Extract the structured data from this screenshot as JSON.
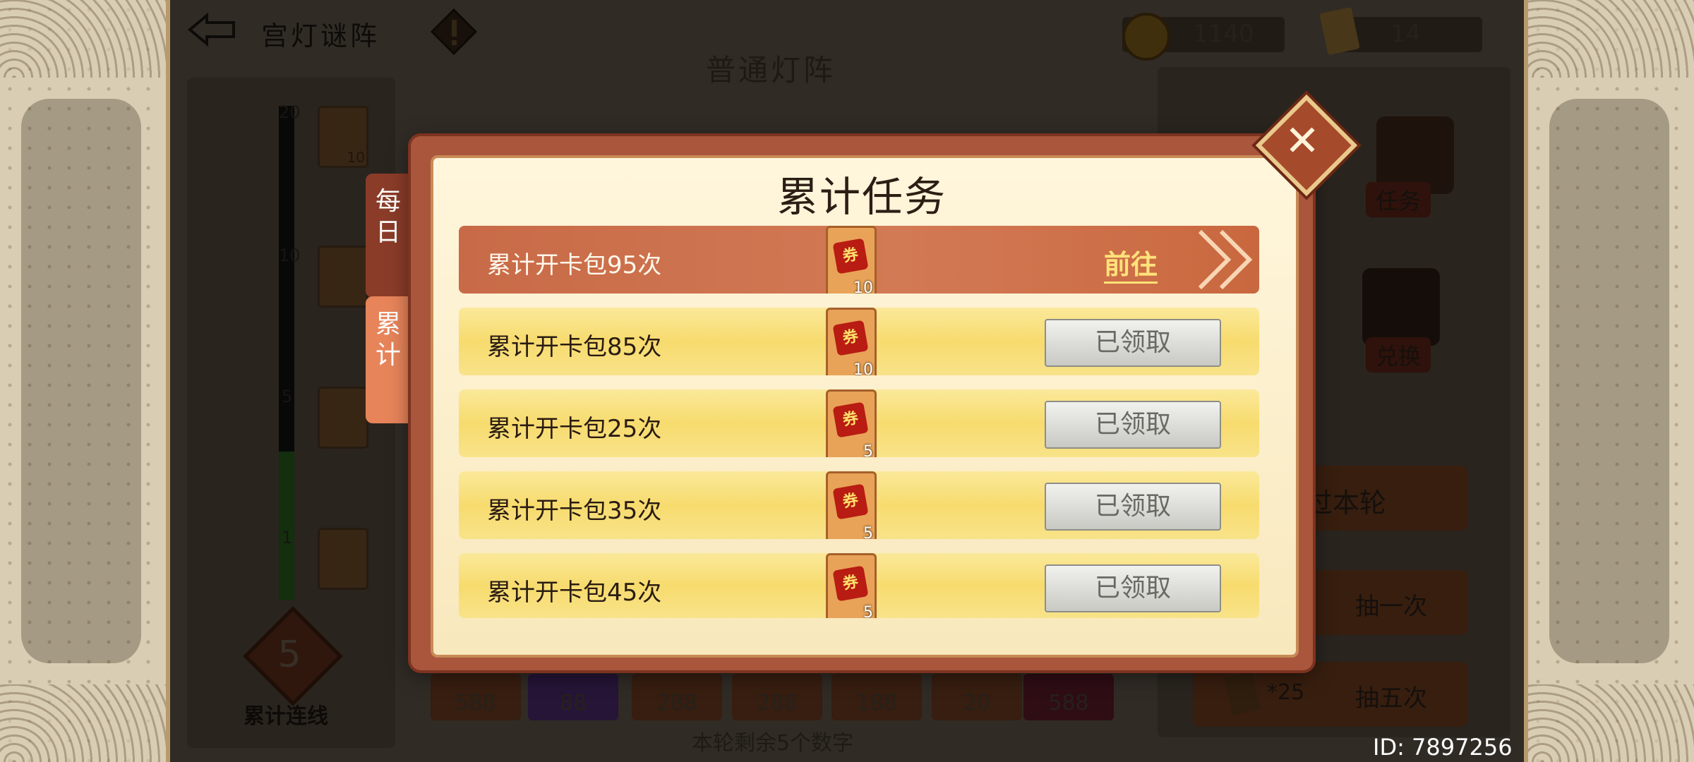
{
  "header": {
    "title": "宫灯谜阵",
    "coins": "1140",
    "tickets": "14"
  },
  "mode_title": "普通灯阵",
  "progress": {
    "ticks": [
      "20",
      "10",
      "5",
      "1"
    ],
    "reward_counts": [
      "10"
    ],
    "fill_fraction": 0.3
  },
  "streak": {
    "value": "5",
    "label": "累计连线"
  },
  "right": {
    "task_label": "任务",
    "exchange_label": "兑换",
    "skip_label": "过本轮",
    "draw_one": "抽一次",
    "draw_five": "抽五次",
    "cost_five": "*25"
  },
  "bottom_chips": [
    "588",
    "88",
    "288",
    "288",
    "188",
    "20",
    "588"
  ],
  "round_remaining": "本轮剩余5个数字",
  "user_id": "ID: 7897256",
  "modal": {
    "title": "累计任务",
    "tabs": [
      "每日",
      "累计"
    ],
    "tasks": [
      {
        "label": "累计开卡包95次",
        "reward": "10",
        "status": "前往"
      },
      {
        "label": "累计开卡包85次",
        "reward": "10",
        "status": "已领取"
      },
      {
        "label": "累计开卡包25次",
        "reward": "5",
        "status": "已领取"
      },
      {
        "label": "累计开卡包35次",
        "reward": "5",
        "status": "已领取"
      },
      {
        "label": "累计开卡包45次",
        "reward": "5",
        "status": "已领取"
      }
    ]
  },
  "icons": {
    "back": "back-arrow-icon",
    "warning": "warning-icon",
    "coin": "coin-icon",
    "ticket": "ticket-icon",
    "close": "close-icon"
  },
  "colors": {
    "active_row": "#c86a47",
    "claimed_row": "#f7db6e",
    "go_text": "#ffe27a"
  }
}
